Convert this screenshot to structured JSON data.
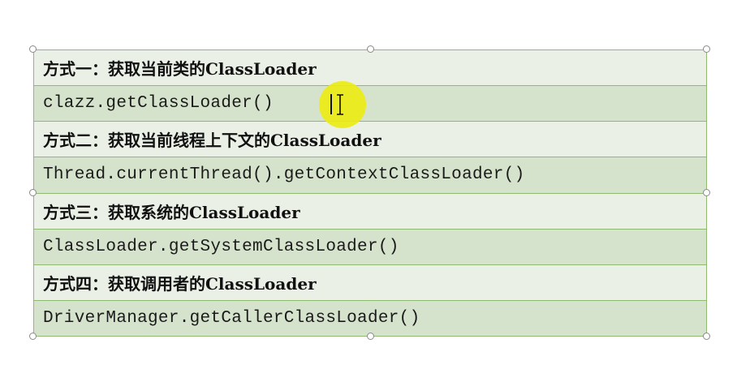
{
  "rows": [
    {
      "kind": "heading",
      "text": "方式一：获取当前类的ClassLoader"
    },
    {
      "kind": "code",
      "text": "clazz.getClassLoader()"
    },
    {
      "kind": "heading",
      "text": "方式二：获取当前线程上下文的ClassLoader"
    },
    {
      "kind": "code",
      "text": "Thread.currentThread().getContextClassLoader()"
    },
    {
      "kind": "heading",
      "text": "方式三：获取系统的ClassLoader"
    },
    {
      "kind": "code",
      "text": "ClassLoader.getSystemClassLoader()"
    },
    {
      "kind": "heading",
      "text": "方式四：获取调用者的ClassLoader"
    },
    {
      "kind": "code",
      "text": "DriverManager.getCallerClassLoader()"
    }
  ],
  "colors": {
    "heading_bg": "#eaf0e6",
    "code_bg": "#d6e3cc",
    "border": "#8fba6f",
    "cursor_highlight": "#ecec14"
  },
  "icons": {
    "cursor": "i-beam-cursor-icon",
    "selection_handles": "resize-handle-icon"
  }
}
